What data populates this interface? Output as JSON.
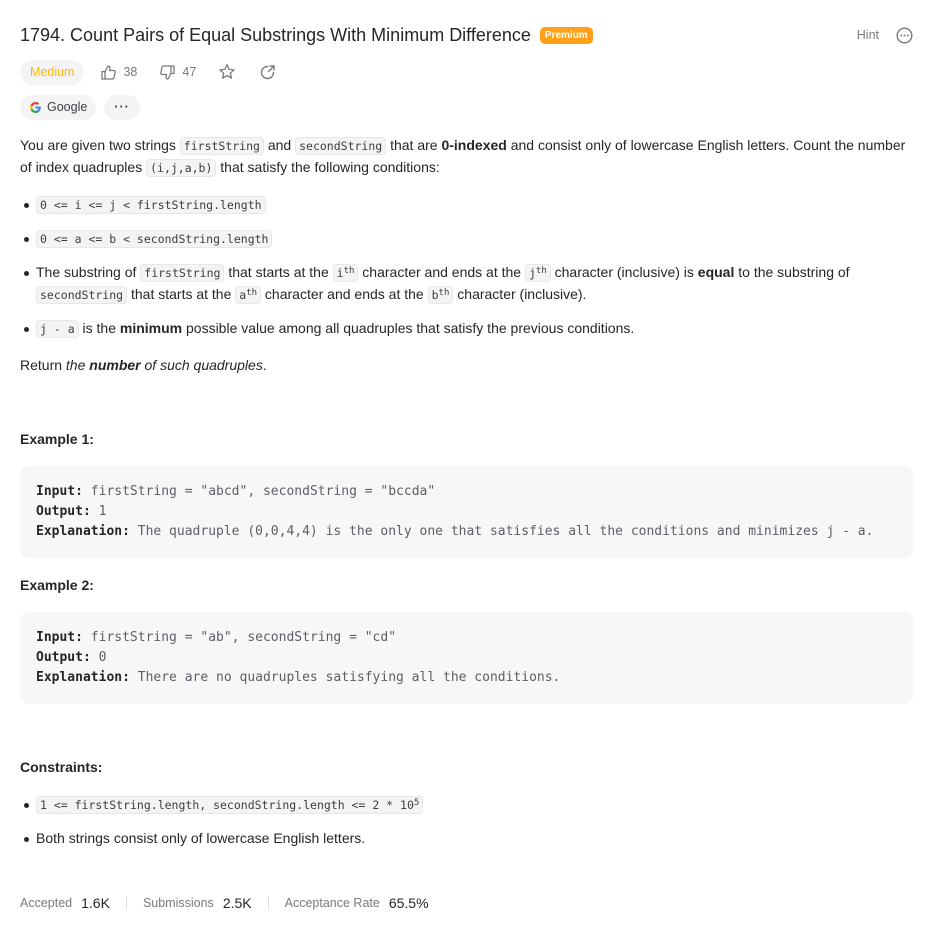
{
  "header": {
    "title": "1794. Count Pairs of Equal Substrings With Minimum Difference",
    "premium_badge": "Premium",
    "hint_label": "Hint"
  },
  "meta": {
    "difficulty": "Medium",
    "likes": "38",
    "dislikes": "47"
  },
  "tags": {
    "company": "Google",
    "more": "···"
  },
  "description": {
    "p1_a": "You are given two strings ",
    "p1_code1": "firstString",
    "p1_b": " and ",
    "p1_code2": "secondString",
    "p1_c": " that are ",
    "p1_bold": "0-indexed",
    "p1_d": " and consist only of lowercase English letters. Count the number of index quadruples ",
    "p1_code3": "(i,j,a,b)",
    "p1_e": " that satisfy the following conditions:",
    "cond1": "0 <= i <= j < firstString.length",
    "cond2": "0 <= a <= b < secondString.length",
    "cond3_a": "The substring of ",
    "cond3_code1": "firstString",
    "cond3_b": " that starts at the ",
    "cond3_i": "i",
    "cond3_th1": "th",
    "cond3_c": " character and ends at the ",
    "cond3_j": "j",
    "cond3_th2": "th",
    "cond3_d": " character (inclusive) is ",
    "cond3_bold": "equal",
    "cond3_e": " to the substring of ",
    "cond3_code2": "secondString",
    "cond3_f": " that starts at the ",
    "cond3_a_var": "a",
    "cond3_th3": "th",
    "cond3_g": " character and ends at the ",
    "cond3_b_var": "b",
    "cond3_th4": "th",
    "cond3_h": " character (inclusive).",
    "cond4_code": "j - a",
    "cond4_a": " is the ",
    "cond4_bold": "minimum",
    "cond4_b": " possible value among all quadruples that satisfy the previous conditions.",
    "ret_a": "Return ",
    "ret_i1": "the ",
    "ret_bi": "number",
    "ret_i2": " of such quadruples",
    "ret_b": "."
  },
  "examples": [
    {
      "title": "Example 1:",
      "input_label": "Input:",
      "input": " firstString = \"abcd\", secondString = \"bccda\"",
      "output_label": "Output:",
      "output": " 1",
      "explanation_label": "Explanation:",
      "explanation": " The quadruple (0,0,4,4) is the only one that satisfies all the conditions and minimizes j - a."
    },
    {
      "title": "Example 2:",
      "input_label": "Input:",
      "input": " firstString = \"ab\", secondString = \"cd\"",
      "output_label": "Output:",
      "output": " 0",
      "explanation_label": "Explanation:",
      "explanation": " There are no quadruples satisfying all the conditions."
    }
  ],
  "constraints": {
    "title": "Constraints:",
    "c1": "1 <= firstString.length, secondString.length <= 2 * 10",
    "c1_exp": "5",
    "c2": "Both strings consist only of lowercase English letters."
  },
  "footer": {
    "accepted_label": "Accepted",
    "accepted": "1.6K",
    "submissions_label": "Submissions",
    "submissions": "2.5K",
    "rate_label": "Acceptance Rate",
    "rate": "65.5%"
  },
  "colors": {
    "premium": "#ffa116",
    "difficulty": "#ffb800"
  }
}
